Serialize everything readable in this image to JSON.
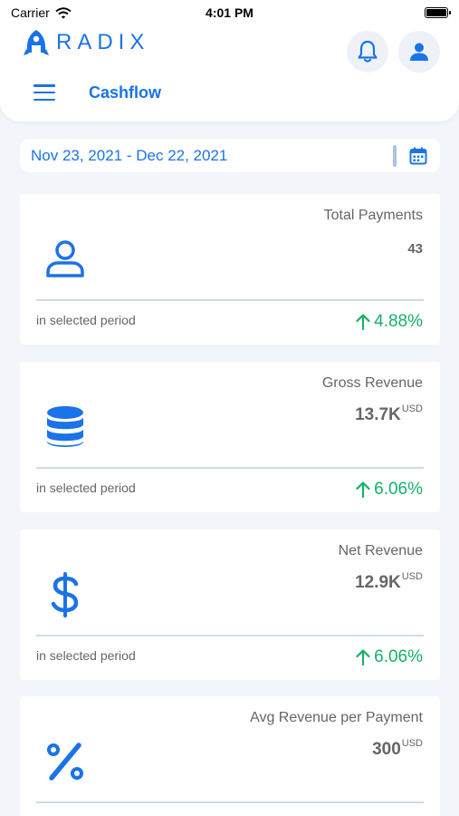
{
  "status_bar": {
    "carrier": "Carrier",
    "time": "4:01 PM"
  },
  "header": {
    "logo_text": "RADIX",
    "title": "Cashflow"
  },
  "date_range": {
    "value": "Nov 23, 2021 - Dec 22, 2021"
  },
  "cards": [
    {
      "title": "Total Payments",
      "value": "43",
      "unit": "",
      "footnote": "in selected period",
      "change": "4.88%",
      "icon": "user-icon"
    },
    {
      "title": "Gross Revenue",
      "value": "13.7K",
      "unit": "USD",
      "footnote": "in selected period",
      "change": "6.06%",
      "icon": "database-icon"
    },
    {
      "title": "Net Revenue",
      "value": "12.9K",
      "unit": "USD",
      "footnote": "in selected period",
      "change": "6.06%",
      "icon": "dollar-icon"
    },
    {
      "title": "Avg Revenue per Payment",
      "value": "300",
      "unit": "USD",
      "footnote": "",
      "change": "",
      "icon": "percent-icon"
    }
  ],
  "colors": {
    "accent": "#1a73e8",
    "positive": "#16b06a",
    "background": "#f2f5fa"
  }
}
